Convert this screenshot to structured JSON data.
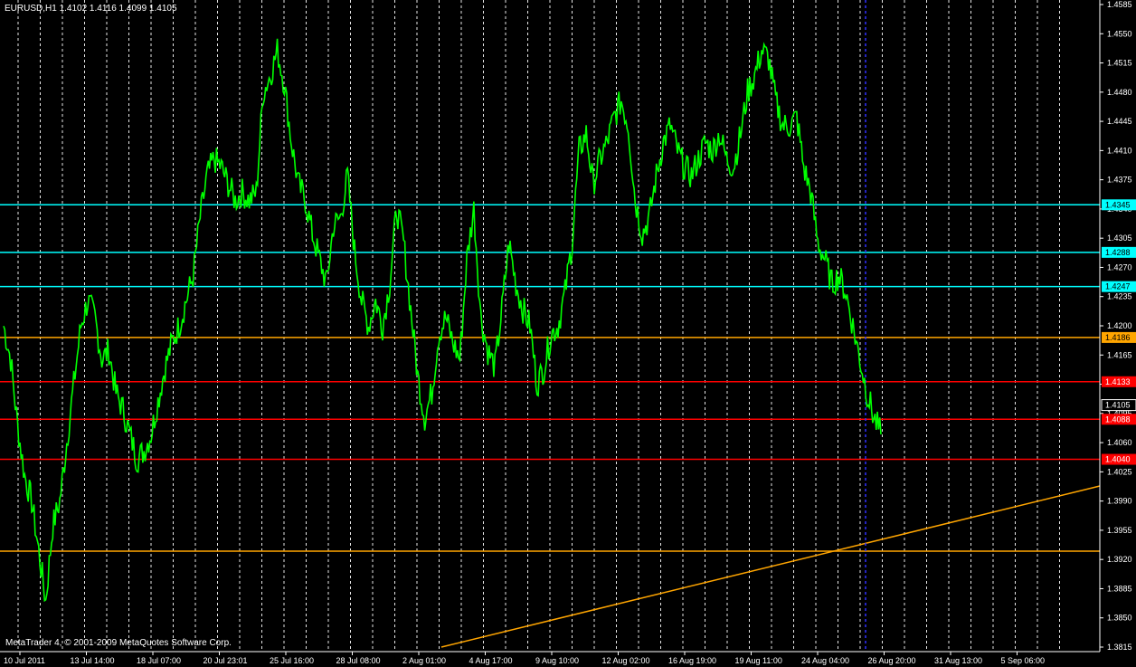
{
  "header": {
    "symbol_info": "EURUSD,H1  1.4102 1.4116 1.4099 1.4105"
  },
  "footer": {
    "copyright": "MetaTrader 4, © 2001-2009 MetaQuotes Software Corp."
  },
  "colors": {
    "background": "#000000",
    "price_line": "#00ff00",
    "grid": "#ffffff",
    "cyan": "#00ffff",
    "orange": "#ffa500",
    "red": "#ff0000",
    "period_separator": "#3030ff"
  },
  "chart_data": {
    "type": "line",
    "symbol": "EURUSD",
    "timeframe": "H1",
    "ylim": [
      1.3815,
      1.4585
    ],
    "yticks": [
      "1.4585",
      "1.4550",
      "1.4515",
      "1.4480",
      "1.4445",
      "1.4410",
      "1.4375",
      "1.4340",
      "1.4305",
      "1.4270",
      "1.4235",
      "1.4200",
      "1.4165",
      "1.4130",
      "1.4095",
      "1.4060",
      "1.4025",
      "1.3990",
      "1.3955",
      "1.3920",
      "1.3885",
      "1.3850",
      "1.3815"
    ],
    "xticks": [
      "10 Jul 2011",
      "13 Jul 14:00",
      "18 Jul 07:00",
      "20 Jul 23:01",
      "25 Jul 16:00",
      "28 Jul 08:00",
      "2 Aug 01:00",
      "4 Aug 17:00",
      "9 Aug 10:00",
      "12 Aug 02:00",
      "16 Aug 19:00",
      "19 Aug 11:00",
      "24 Aug 04:00",
      "26 Aug 20:00",
      "31 Aug 13:00",
      "5 Sep 06:00"
    ],
    "current_price": {
      "label": "1.4105",
      "value": 1.4105
    },
    "horizontal_lines": [
      {
        "value": 1.4345,
        "label": "1.4345",
        "color": "cyan"
      },
      {
        "value": 1.4288,
        "label": "1.4288",
        "color": "cyan"
      },
      {
        "value": 1.4247,
        "label": "1.4247",
        "color": "cyan"
      },
      {
        "value": 1.4186,
        "label": "1.4186",
        "color": "orange"
      },
      {
        "value": 1.4133,
        "label": "1.4133",
        "color": "red"
      },
      {
        "value": 1.4088,
        "label": "1.4088",
        "color": "red"
      },
      {
        "value": 1.404,
        "label": "1.4040",
        "color": "red"
      },
      {
        "value": 1.393,
        "label": "",
        "color": "orange"
      }
    ],
    "trendline": {
      "color": "orange",
      "from_price": 1.3815,
      "to_price": 1.4008
    },
    "price_series": [
      1.42,
      1.416,
      1.408,
      1.402,
      1.399,
      1.393,
      1.387,
      1.396,
      1.399,
      1.406,
      1.413,
      1.42,
      1.423,
      1.421,
      1.416,
      1.417,
      1.412,
      1.41,
      1.407,
      1.404,
      1.405,
      1.407,
      1.411,
      1.415,
      1.418,
      1.42,
      1.423,
      1.426,
      1.433,
      1.438,
      1.44,
      1.439,
      1.437,
      1.435,
      1.436,
      1.435,
      1.436,
      1.448,
      1.45,
      1.453,
      1.449,
      1.442,
      1.437,
      1.435,
      1.431,
      1.428,
      1.425,
      1.432,
      1.433,
      1.438,
      1.429,
      1.423,
      1.42,
      1.423,
      1.42,
      1.425,
      1.434,
      1.43,
      1.422,
      1.414,
      1.409,
      1.412,
      1.419,
      1.421,
      1.418,
      1.416,
      1.428,
      1.434,
      1.421,
      1.417,
      1.415,
      1.422,
      1.43,
      1.425,
      1.422,
      1.42,
      1.413,
      1.415,
      1.419,
      1.42,
      1.424,
      1.43,
      1.441,
      1.443,
      1.437,
      1.44,
      1.442,
      1.445,
      1.447,
      1.444,
      1.435,
      1.431,
      1.433,
      1.438,
      1.442,
      1.444,
      1.441,
      1.439,
      1.438,
      1.44,
      1.442,
      1.441,
      1.443,
      1.44,
      1.439,
      1.443,
      1.448,
      1.45,
      1.453,
      1.452,
      1.447,
      1.444,
      1.444,
      1.445,
      1.439,
      1.436,
      1.43,
      1.428,
      1.425,
      1.426,
      1.424,
      1.42,
      1.416,
      1.412,
      1.409,
      1.407
    ]
  }
}
